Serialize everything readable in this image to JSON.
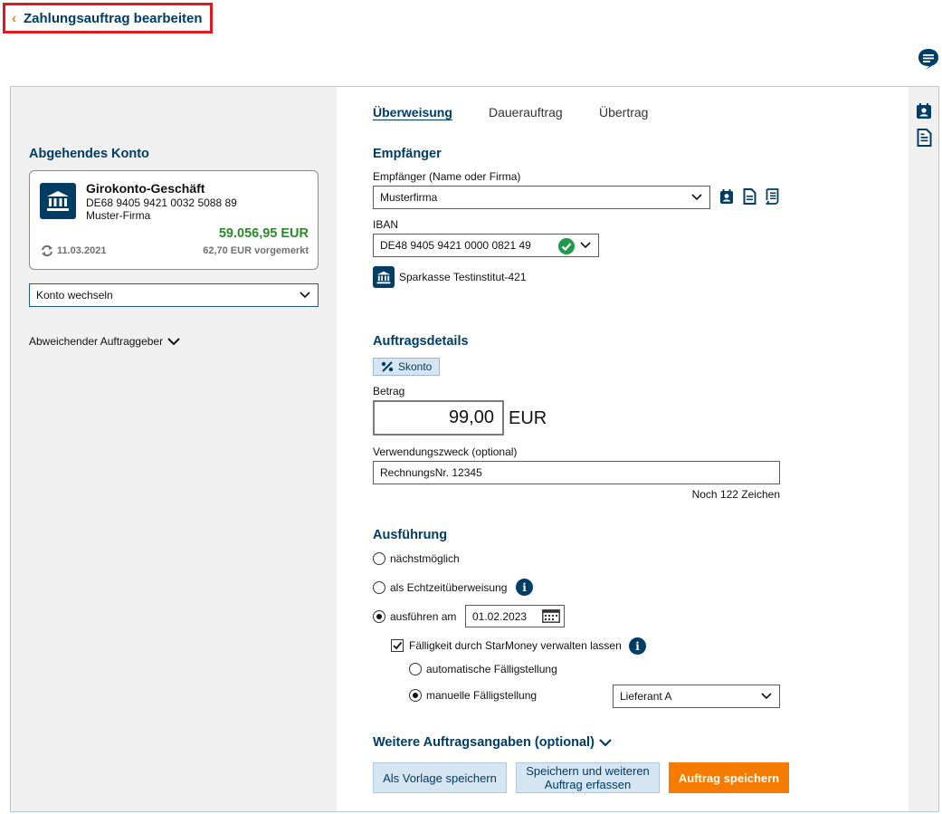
{
  "header": {
    "back_chevron": "‹",
    "title": "Zahlungsauftrag bearbeiten",
    "chat_icon": "chat-bubble-icon"
  },
  "left": {
    "section_title": "Abgehendes Konto",
    "account": {
      "name": "Girokonto-Geschäft",
      "iban": "DE68 9405 9421 0032 5088 89",
      "owner": "Muster-Firma",
      "balance": "59.056,95 EUR",
      "date": "11.03.2021",
      "pending": "62,70 EUR vorgemerkt"
    },
    "switch_account": "Konto wechseln",
    "different_payer": "Abweichender Auftraggeber"
  },
  "tabs": [
    {
      "label": "Überweisung",
      "active": true
    },
    {
      "label": "Dauerauftrag",
      "active": false
    },
    {
      "label": "Übertrag",
      "active": false
    }
  ],
  "recipient": {
    "section_title": "Empfänger",
    "name_label": "Empfänger (Name oder Firma)",
    "name_value": "Musterfirma",
    "iban_label": "IBAN",
    "iban_value": "DE48 9405 9421 0000 0821 49",
    "bank_name": "Sparkasse Testinstitut-421"
  },
  "details": {
    "section_title": "Auftragsdetails",
    "skonto_label": "Skonto",
    "amount_label": "Betrag",
    "amount_value": "99,00",
    "currency": "EUR",
    "purpose_label": "Verwendungszweck (optional)",
    "purpose_value": "RechnungsNr. 12345",
    "chars_left": "Noch 122 Zeichen"
  },
  "execution": {
    "section_title": "Ausführung",
    "option_next": "nächstmöglich",
    "option_realtime": "als Echtzeitüberweisung",
    "option_date": "ausführen am",
    "date_value": "01.02.2023",
    "manage_label": "Fälligkeit durch StarMoney verwalten lassen",
    "auto_due": "automatische Fälligstellung",
    "manual_due": "manuelle Fälligstellung",
    "supplier_value": "Lieferant A"
  },
  "more": {
    "title": "Weitere Auftragsangaben (optional)"
  },
  "buttons": {
    "save_template": "Als Vorlage speichern",
    "save_and_new": "Speichern und weiteren Auftrag erfassen",
    "save_order": "Auftrag speichern"
  },
  "colors": {
    "brand_blue": "#003d64",
    "accent_orange": "#f57c00",
    "balance_green": "#2a8a2a",
    "check_green": "#1e9b4a",
    "highlight_red": "#e0191f"
  }
}
